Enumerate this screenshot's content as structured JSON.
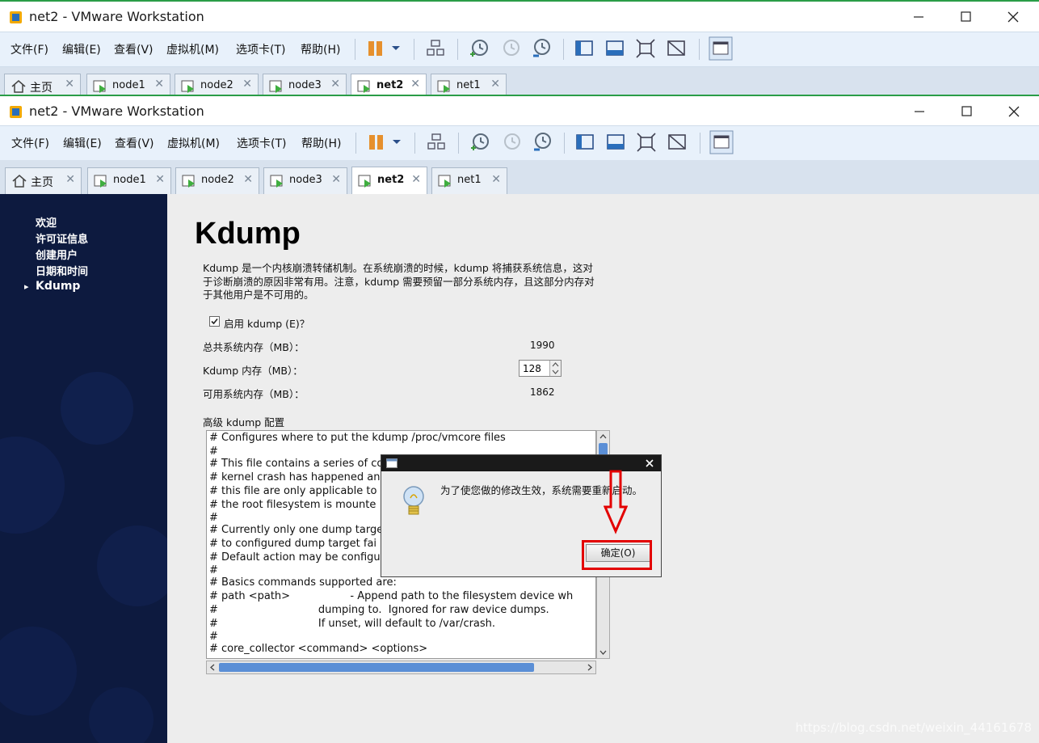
{
  "outer_window": {
    "title": "net2 - VMware Workstation",
    "menu": [
      "文件(F)",
      "编辑(E)",
      "查看(V)",
      "虚拟机(M)",
      "选项卡(T)",
      "帮助(H)"
    ],
    "tabs": [
      {
        "label": "主页",
        "active": false
      },
      {
        "label": "node1",
        "active": false
      },
      {
        "label": "node2",
        "active": false
      },
      {
        "label": "node3",
        "active": false
      },
      {
        "label": "net2",
        "active": true
      },
      {
        "label": "net1",
        "active": false
      }
    ]
  },
  "inner_window": {
    "title": "net2 - VMware Workstation",
    "menu": [
      "文件(F)",
      "编辑(E)",
      "查看(V)",
      "虚拟机(M)",
      "选项卡(T)",
      "帮助(H)"
    ],
    "tabs": [
      {
        "label": "主页",
        "active": false
      },
      {
        "label": "node1",
        "active": false
      },
      {
        "label": "node2",
        "active": false
      },
      {
        "label": "node3",
        "active": false
      },
      {
        "label": "net2",
        "active": true
      },
      {
        "label": "net1",
        "active": false
      }
    ]
  },
  "sidebar": {
    "items": [
      "欢迎",
      "许可证信息",
      "创建用户",
      "日期和时间",
      "Kdump"
    ],
    "current": "Kdump"
  },
  "page": {
    "title": "Kdump",
    "description": "Kdump 是一个内核崩溃转储机制。在系统崩溃的时候，kdump 将捕获系统信息，这对于诊断崩溃的原因非常有用。注意，kdump 需要预留一部分系统内存，且这部分内存对于其他用户是不可用的。",
    "enable_label": "启用 kdump (E)？",
    "enable_checked": true,
    "total_mem_label": "总共系统内存（MB）：",
    "total_mem_value": "1990",
    "kdump_mem_label": "Kdump 内存（MB）：",
    "kdump_mem_value": "128",
    "usable_mem_label": "可用系统内存（MB）：",
    "usable_mem_value": "1862",
    "advanced_label": "高级 kdump 配置",
    "config_lines": [
      "# Configures where to put the kdump /proc/vmcore files",
      "#",
      "# This file contains a series of co",
      "# kernel crash has happened an",
      "# this file are only applicable to",
      "# the root filesystem is mounte",
      "#",
      "# Currently only one dump targe",
      "# to configured dump target fai",
      "# Default action may be configu",
      "#",
      "# Basics commands supported are:",
      "# path <path>                  - Append path to the filesystem device wh",
      "#                              dumping to.  Ignored for raw device dumps.",
      "#                              If unset, will default to /var/crash.",
      "#",
      "# core_collector <command> <options>"
    ]
  },
  "dialog": {
    "message": "为了使您做的修改生效，系统需要重新启动。",
    "ok_label": "确定(O)"
  },
  "watermark": "https://blog.csdn.net/weixin_44161678",
  "colors": {
    "sidebar_bg": "#0d1a3f",
    "highlight": "#e30000",
    "menubar_bg": "#e8f1fb"
  }
}
